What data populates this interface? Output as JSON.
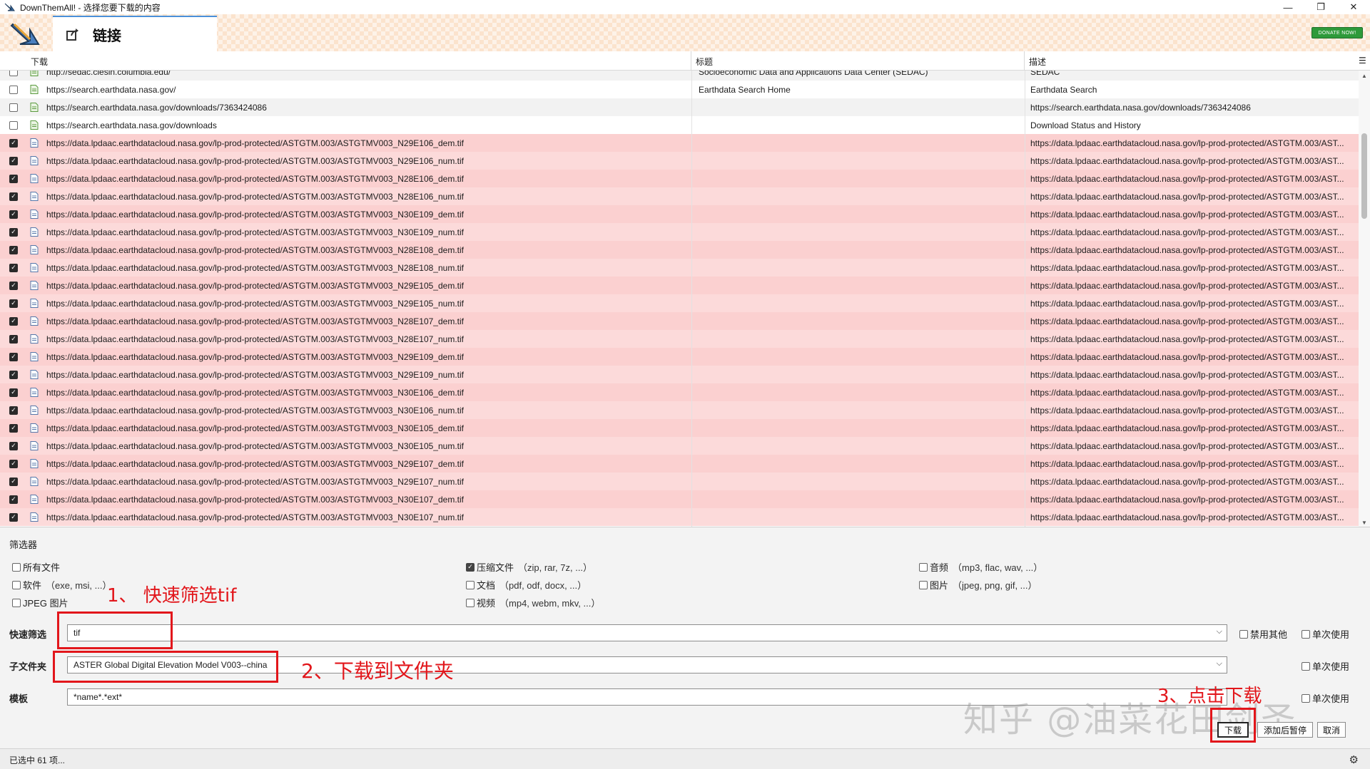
{
  "window": {
    "title": "DownThemAll! - 选择您要下载的内容",
    "controls": [
      "—",
      "❐",
      "✕"
    ]
  },
  "header": {
    "tab_label": "链接",
    "donate_label": "DONATE NOW!"
  },
  "table": {
    "columns": [
      "下载",
      "标题",
      "描述"
    ],
    "rows": [
      {
        "checked": false,
        "url": "http://sedac.ciesin.columbia.edu/",
        "title": "Socioeconomic Data and Applications Data Center (SEDAC)",
        "desc": "SEDAC"
      },
      {
        "checked": false,
        "url": "https://search.earthdata.nasa.gov/",
        "title": "Earthdata Search Home",
        "desc": "Earthdata Search"
      },
      {
        "checked": false,
        "url": "https://search.earthdata.nasa.gov/downloads/7363424086",
        "title": "",
        "desc": "https://search.earthdata.nasa.gov/downloads/7363424086"
      },
      {
        "checked": false,
        "url": "https://search.earthdata.nasa.gov/downloads",
        "title": "",
        "desc": "Download Status and History"
      },
      {
        "checked": true,
        "url": "https://data.lpdaac.earthdatacloud.nasa.gov/lp-prod-protected/ASTGTM.003/ASTGTMV003_N29E106_dem.tif",
        "title": "",
        "desc": "https://data.lpdaac.earthdatacloud.nasa.gov/lp-prod-protected/ASTGTM.003/AST..."
      },
      {
        "checked": true,
        "url": "https://data.lpdaac.earthdatacloud.nasa.gov/lp-prod-protected/ASTGTM.003/ASTGTMV003_N29E106_num.tif",
        "title": "",
        "desc": "https://data.lpdaac.earthdatacloud.nasa.gov/lp-prod-protected/ASTGTM.003/AST..."
      },
      {
        "checked": true,
        "url": "https://data.lpdaac.earthdatacloud.nasa.gov/lp-prod-protected/ASTGTM.003/ASTGTMV003_N28E106_dem.tif",
        "title": "",
        "desc": "https://data.lpdaac.earthdatacloud.nasa.gov/lp-prod-protected/ASTGTM.003/AST..."
      },
      {
        "checked": true,
        "url": "https://data.lpdaac.earthdatacloud.nasa.gov/lp-prod-protected/ASTGTM.003/ASTGTMV003_N28E106_num.tif",
        "title": "",
        "desc": "https://data.lpdaac.earthdatacloud.nasa.gov/lp-prod-protected/ASTGTM.003/AST..."
      },
      {
        "checked": true,
        "url": "https://data.lpdaac.earthdatacloud.nasa.gov/lp-prod-protected/ASTGTM.003/ASTGTMV003_N30E109_dem.tif",
        "title": "",
        "desc": "https://data.lpdaac.earthdatacloud.nasa.gov/lp-prod-protected/ASTGTM.003/AST..."
      },
      {
        "checked": true,
        "url": "https://data.lpdaac.earthdatacloud.nasa.gov/lp-prod-protected/ASTGTM.003/ASTGTMV003_N30E109_num.tif",
        "title": "",
        "desc": "https://data.lpdaac.earthdatacloud.nasa.gov/lp-prod-protected/ASTGTM.003/AST..."
      },
      {
        "checked": true,
        "url": "https://data.lpdaac.earthdatacloud.nasa.gov/lp-prod-protected/ASTGTM.003/ASTGTMV003_N28E108_dem.tif",
        "title": "",
        "desc": "https://data.lpdaac.earthdatacloud.nasa.gov/lp-prod-protected/ASTGTM.003/AST..."
      },
      {
        "checked": true,
        "url": "https://data.lpdaac.earthdatacloud.nasa.gov/lp-prod-protected/ASTGTM.003/ASTGTMV003_N28E108_num.tif",
        "title": "",
        "desc": "https://data.lpdaac.earthdatacloud.nasa.gov/lp-prod-protected/ASTGTM.003/AST..."
      },
      {
        "checked": true,
        "url": "https://data.lpdaac.earthdatacloud.nasa.gov/lp-prod-protected/ASTGTM.003/ASTGTMV003_N29E105_dem.tif",
        "title": "",
        "desc": "https://data.lpdaac.earthdatacloud.nasa.gov/lp-prod-protected/ASTGTM.003/AST..."
      },
      {
        "checked": true,
        "url": "https://data.lpdaac.earthdatacloud.nasa.gov/lp-prod-protected/ASTGTM.003/ASTGTMV003_N29E105_num.tif",
        "title": "",
        "desc": "https://data.lpdaac.earthdatacloud.nasa.gov/lp-prod-protected/ASTGTM.003/AST..."
      },
      {
        "checked": true,
        "url": "https://data.lpdaac.earthdatacloud.nasa.gov/lp-prod-protected/ASTGTM.003/ASTGTMV003_N28E107_dem.tif",
        "title": "",
        "desc": "https://data.lpdaac.earthdatacloud.nasa.gov/lp-prod-protected/ASTGTM.003/AST..."
      },
      {
        "checked": true,
        "url": "https://data.lpdaac.earthdatacloud.nasa.gov/lp-prod-protected/ASTGTM.003/ASTGTMV003_N28E107_num.tif",
        "title": "",
        "desc": "https://data.lpdaac.earthdatacloud.nasa.gov/lp-prod-protected/ASTGTM.003/AST..."
      },
      {
        "checked": true,
        "url": "https://data.lpdaac.earthdatacloud.nasa.gov/lp-prod-protected/ASTGTM.003/ASTGTMV003_N29E109_dem.tif",
        "title": "",
        "desc": "https://data.lpdaac.earthdatacloud.nasa.gov/lp-prod-protected/ASTGTM.003/AST..."
      },
      {
        "checked": true,
        "url": "https://data.lpdaac.earthdatacloud.nasa.gov/lp-prod-protected/ASTGTM.003/ASTGTMV003_N29E109_num.tif",
        "title": "",
        "desc": "https://data.lpdaac.earthdatacloud.nasa.gov/lp-prod-protected/ASTGTM.003/AST..."
      },
      {
        "checked": true,
        "url": "https://data.lpdaac.earthdatacloud.nasa.gov/lp-prod-protected/ASTGTM.003/ASTGTMV003_N30E106_dem.tif",
        "title": "",
        "desc": "https://data.lpdaac.earthdatacloud.nasa.gov/lp-prod-protected/ASTGTM.003/AST..."
      },
      {
        "checked": true,
        "url": "https://data.lpdaac.earthdatacloud.nasa.gov/lp-prod-protected/ASTGTM.003/ASTGTMV003_N30E106_num.tif",
        "title": "",
        "desc": "https://data.lpdaac.earthdatacloud.nasa.gov/lp-prod-protected/ASTGTM.003/AST..."
      },
      {
        "checked": true,
        "url": "https://data.lpdaac.earthdatacloud.nasa.gov/lp-prod-protected/ASTGTM.003/ASTGTMV003_N30E105_dem.tif",
        "title": "",
        "desc": "https://data.lpdaac.earthdatacloud.nasa.gov/lp-prod-protected/ASTGTM.003/AST..."
      },
      {
        "checked": true,
        "url": "https://data.lpdaac.earthdatacloud.nasa.gov/lp-prod-protected/ASTGTM.003/ASTGTMV003_N30E105_num.tif",
        "title": "",
        "desc": "https://data.lpdaac.earthdatacloud.nasa.gov/lp-prod-protected/ASTGTM.003/AST..."
      },
      {
        "checked": true,
        "url": "https://data.lpdaac.earthdatacloud.nasa.gov/lp-prod-protected/ASTGTM.003/ASTGTMV003_N29E107_dem.tif",
        "title": "",
        "desc": "https://data.lpdaac.earthdatacloud.nasa.gov/lp-prod-protected/ASTGTM.003/AST..."
      },
      {
        "checked": true,
        "url": "https://data.lpdaac.earthdatacloud.nasa.gov/lp-prod-protected/ASTGTM.003/ASTGTMV003_N29E107_num.tif",
        "title": "",
        "desc": "https://data.lpdaac.earthdatacloud.nasa.gov/lp-prod-protected/ASTGTM.003/AST..."
      },
      {
        "checked": true,
        "url": "https://data.lpdaac.earthdatacloud.nasa.gov/lp-prod-protected/ASTGTM.003/ASTGTMV003_N30E107_dem.tif",
        "title": "",
        "desc": "https://data.lpdaac.earthdatacloud.nasa.gov/lp-prod-protected/ASTGTM.003/AST..."
      },
      {
        "checked": true,
        "url": "https://data.lpdaac.earthdatacloud.nasa.gov/lp-prod-protected/ASTGTM.003/ASTGTMV003_N30E107_num.tif",
        "title": "",
        "desc": "https://data.lpdaac.earthdatacloud.nasa.gov/lp-prod-protected/ASTGTM.003/AST..."
      }
    ]
  },
  "filters": {
    "section_title": "筛选器",
    "options": {
      "all_files": {
        "label": "所有文件",
        "ext": "",
        "checked": false
      },
      "archives": {
        "label": "压缩文件",
        "ext": "（zip, rar, 7z, ...）",
        "checked": true
      },
      "audio": {
        "label": "音频",
        "ext": "（mp3, flac, wav, ...）",
        "checked": false
      },
      "software": {
        "label": "软件",
        "ext": "（exe, msi, ...）",
        "checked": false
      },
      "documents": {
        "label": "文档",
        "ext": "（pdf, odf, docx, ...）",
        "checked": false
      },
      "images": {
        "label": "图片",
        "ext": "（jpeg, png, gif, ...）",
        "checked": false
      },
      "jpeg": {
        "label": "JPEG 图片",
        "ext": "",
        "checked": false
      },
      "video": {
        "label": "视频",
        "ext": "（mp4, webm, mkv, ...）",
        "checked": false
      }
    }
  },
  "form": {
    "fast_filter_label": "快速筛选",
    "fast_filter_value": "tif",
    "disable_others_label": "禁用其他",
    "once_label": "单次使用",
    "subfolder_label": "子文件夹",
    "subfolder_value": "ASTER Global Digital Elevation Model V003--china",
    "mask_label": "模板",
    "mask_value": "*name*.*ext*"
  },
  "annotations": {
    "step1": "1、 快速筛选tif",
    "step2": "2、下载到文件夹",
    "step3": "3、点击下载"
  },
  "buttons": {
    "download": "下载",
    "add_paused": "添加后暂停",
    "cancel": "取消"
  },
  "watermark": "知乎 @油菜花田剑圣",
  "status": {
    "text": "已选中 61 项..."
  },
  "colors": {
    "selected_row": "#fbd0d0",
    "annotation_red": "#e2161b",
    "donate_green": "#2e9a3a"
  }
}
